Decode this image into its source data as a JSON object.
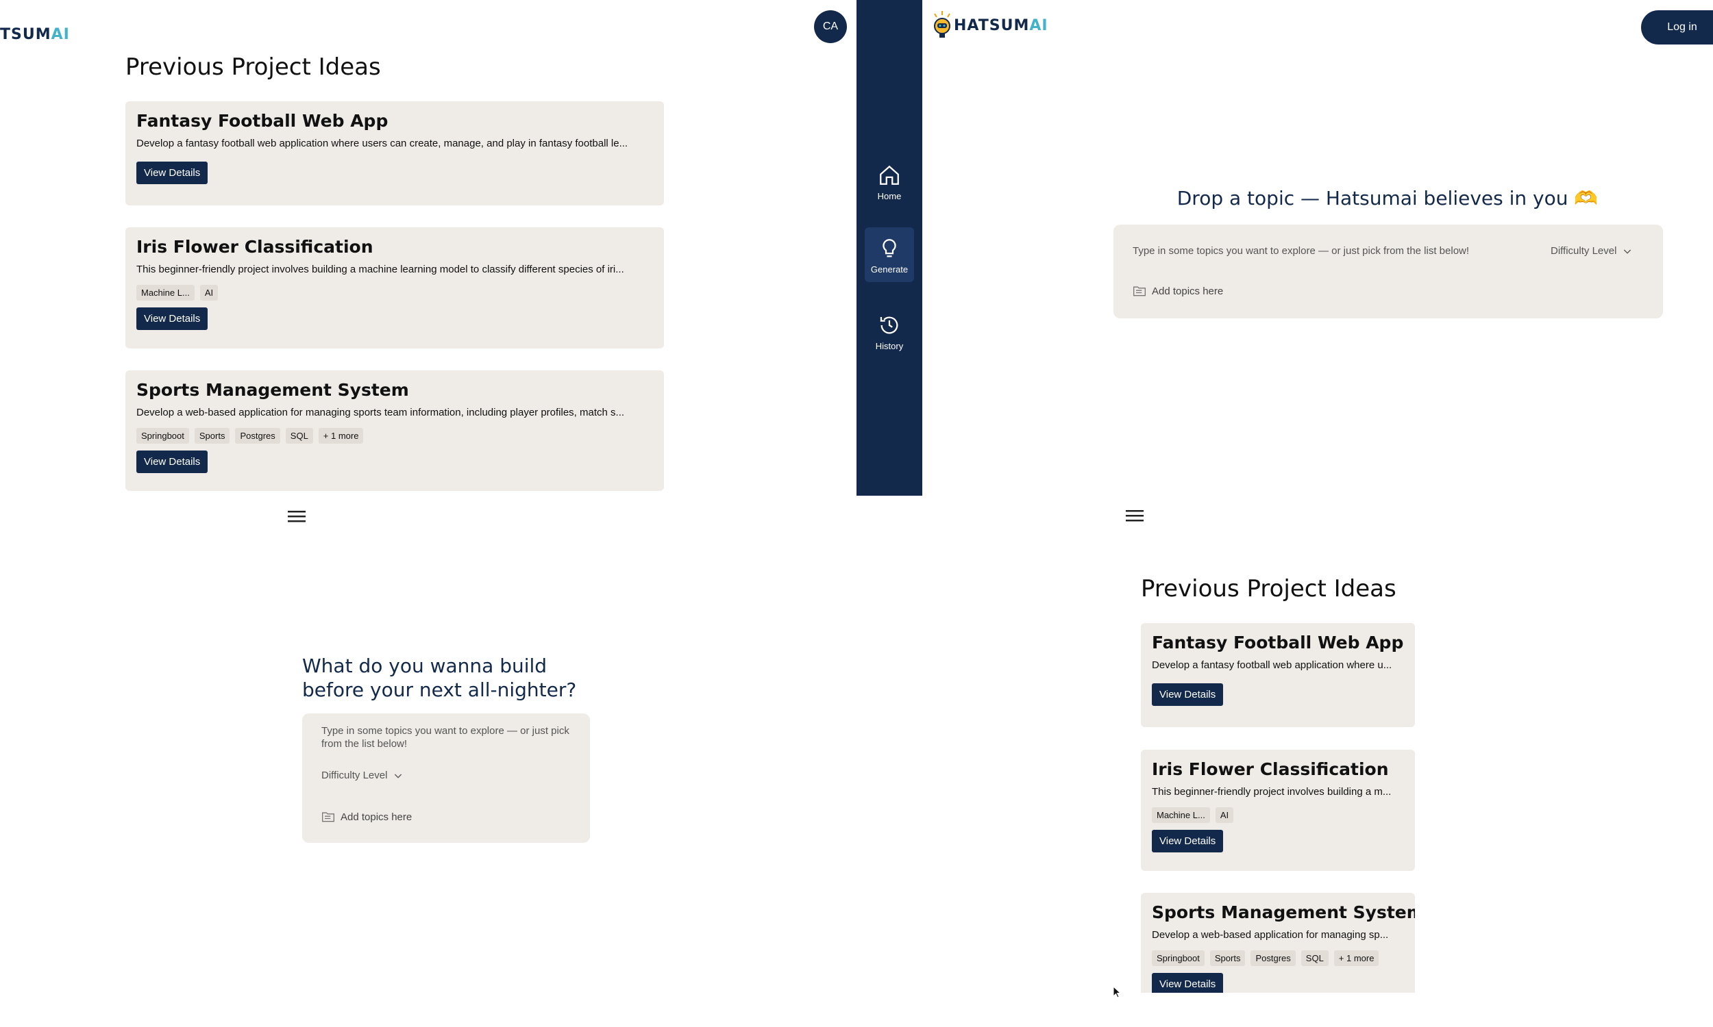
{
  "colors": {
    "navy": "#13294b",
    "accent": "#43b3c9",
    "card_bg": "#efebe6"
  },
  "brand": {
    "logo_left_part": "TSUM",
    "logo_ai": "AI",
    "logo_main": "HATSUM",
    "logo_main_ai": "AI"
  },
  "top_left": {
    "avatar": "CA",
    "title": "Previous Project Ideas",
    "cards": [
      {
        "title": "Fantasy Football Web App",
        "desc": "Develop a fantasy football web application where users can create, manage, and play in fantasy football le...",
        "tags": [],
        "button": "View Details"
      },
      {
        "title": "Iris Flower Classification",
        "desc": "This beginner-friendly project involves building a machine learning model to classify different species of iri...",
        "tags": [
          "Machine L...",
          "AI"
        ],
        "button": "View Details"
      },
      {
        "title": "Sports Management System",
        "desc": "Develop a web-based application for managing sports team information, including player profiles, match s...",
        "tags": [
          "Springboot",
          "Sports",
          "Postgres",
          "SQL",
          "+ 1 more"
        ],
        "button": "View Details"
      }
    ]
  },
  "sidebar": {
    "items": [
      {
        "label": "Home",
        "icon": "home-icon"
      },
      {
        "label": "Generate",
        "icon": "lightbulb-icon"
      },
      {
        "label": "History",
        "icon": "history-icon"
      }
    ]
  },
  "top_right": {
    "login": "Log in",
    "headline": "Drop a topic — Hatsumai believes in you 🫶",
    "placeholder": "Type in some topics you want to explore — or just pick from the list below!",
    "difficulty": "Difficulty Level",
    "add_topics": "Add topics here"
  },
  "bottom_left": {
    "headline_line1": "What do you wanna build",
    "headline_line2": "before your next all-nighter?",
    "placeholder": "Type in some topics you want to explore — or just pick from the list below!",
    "difficulty": "Difficulty Level",
    "add_topics": "Add topics here"
  },
  "bottom_right": {
    "title": "Previous Project Ideas",
    "cards": [
      {
        "title": "Fantasy Football Web App",
        "desc": "Develop a fantasy football web application where u...",
        "tags": [],
        "button": "View Details"
      },
      {
        "title": "Iris Flower Classification",
        "desc": "This beginner-friendly project involves building a m...",
        "tags": [
          "Machine L...",
          "AI"
        ],
        "button": "View Details"
      },
      {
        "title": "Sports Management System",
        "desc": "Develop a web-based application for managing sp...",
        "tags": [
          "Springboot",
          "Sports",
          "Postgres",
          "SQL",
          "+ 1 more"
        ],
        "button": "View Details"
      }
    ]
  }
}
